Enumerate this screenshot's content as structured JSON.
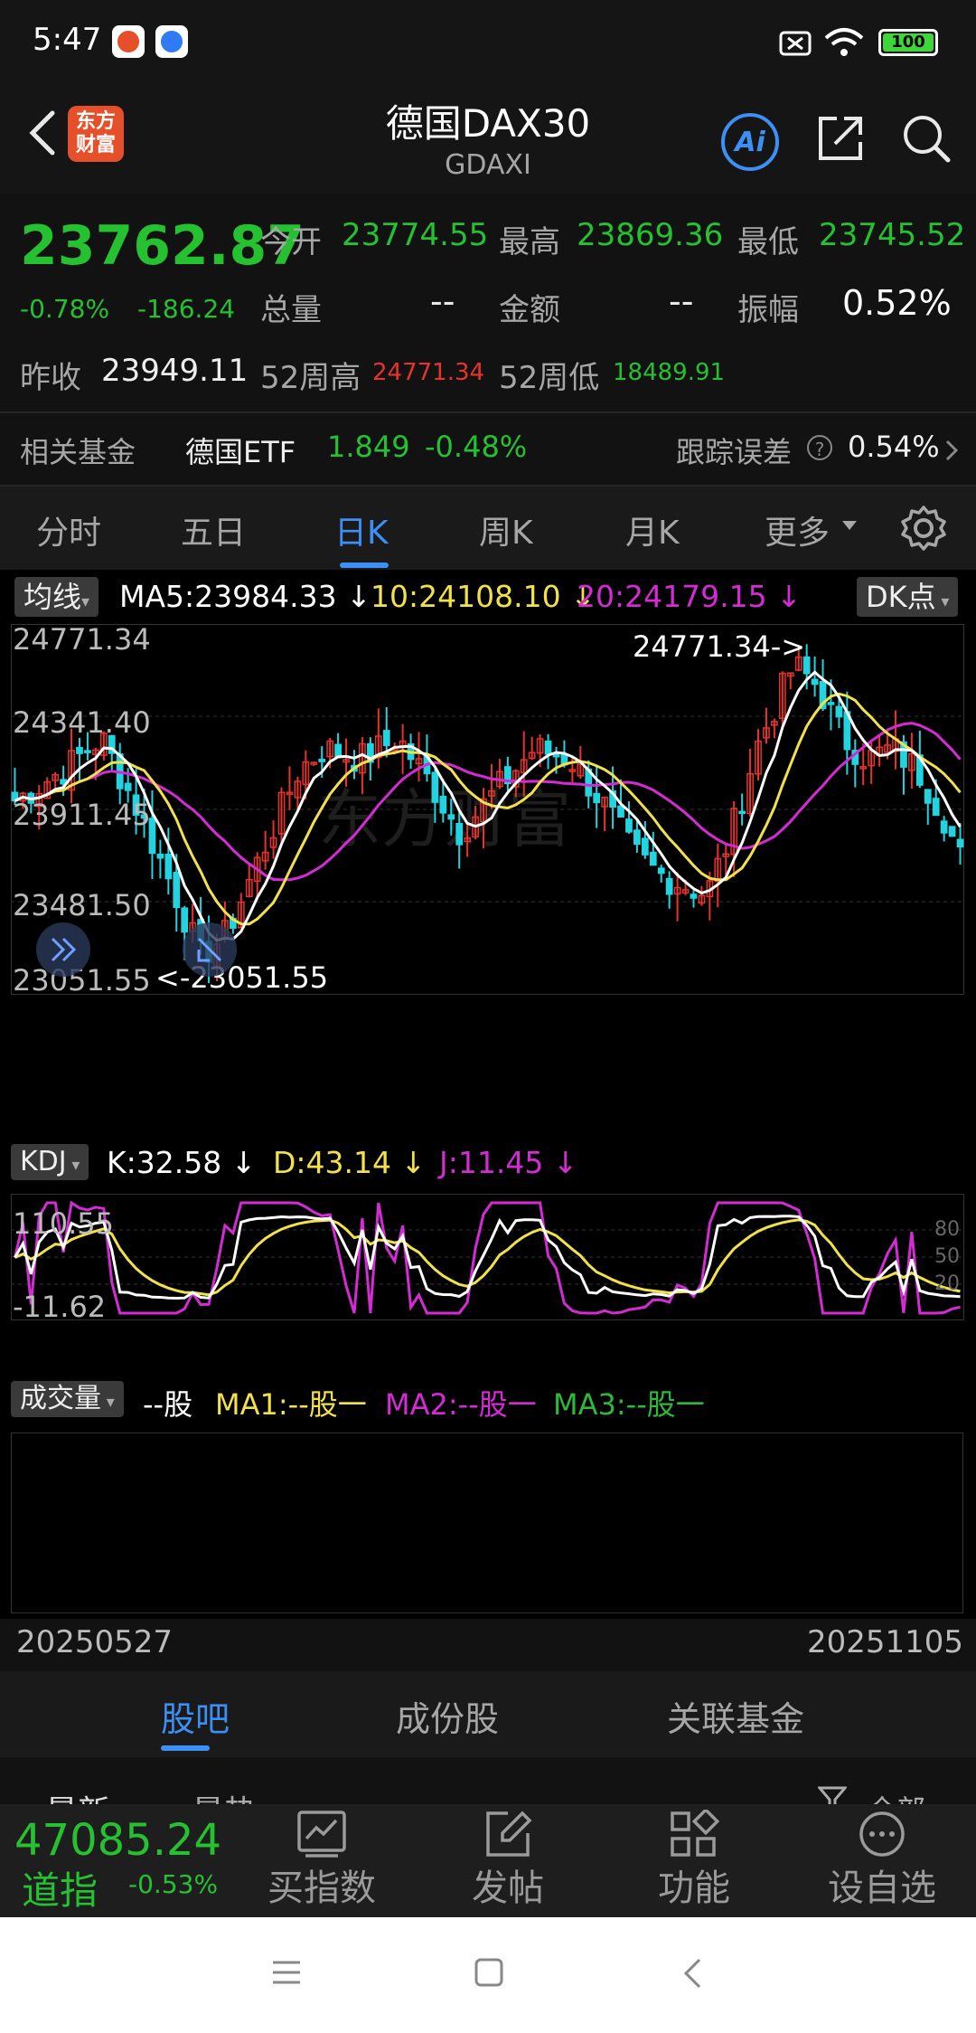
{
  "status": {
    "time": "5:47",
    "battery": "100"
  },
  "header": {
    "title": "德国DAX30",
    "subtitle": "GDAXI",
    "logo": "东方\n财富",
    "ai_label": "Ai"
  },
  "quote": {
    "price": "23762.87",
    "pct": "-0.78%",
    "change": "-186.24",
    "open_label": "今开",
    "open": "23774.55",
    "high_label": "最高",
    "high": "23869.36",
    "low_label": "最低",
    "low": "23745.52",
    "volume_label": "总量",
    "volume": "--",
    "amount_label": "金额",
    "amount": "--",
    "amplitude_label": "振幅",
    "amplitude": "0.52%",
    "prev_label": "昨收",
    "prev": "23949.11",
    "w52_high_label": "52周高",
    "w52_high": "24771.34",
    "w52_low_label": "52周低",
    "w52_low": "18489.91"
  },
  "fund": {
    "label": "相关基金",
    "name": "德国ETF",
    "price": "1.849",
    "pct": "-0.48%",
    "error_label": "跟踪误差",
    "error": "0.54%"
  },
  "tabs": [
    "分时",
    "五日",
    "日K",
    "周K",
    "月K",
    "更多"
  ],
  "main_chart": {
    "indicator": "均线",
    "ma5": "MA5:23984.33",
    "ma10": "10:24108.10",
    "ma20": "20:24179.15",
    "dk": "DK点",
    "y_labels": [
      "24771.34",
      "24341.40",
      "23911.45",
      "23481.50",
      "23051.55"
    ],
    "max_marker": "24771.34->",
    "min_marker": "<-23051.55",
    "watermark": "东方财富"
  },
  "kdj": {
    "label": "KDJ",
    "k": "K:32.58",
    "d": "D:43.14",
    "j": "J:11.45",
    "top": "110.55",
    "bottom": "-11.62",
    "levels": [
      "80",
      "50",
      "20"
    ]
  },
  "volume": {
    "label": "成交量",
    "v": "--股",
    "ma1": "MA1:--股一",
    "ma2": "MA2:--股一",
    "ma3": "MA3:--股一"
  },
  "dates": {
    "start": "20250527",
    "end": "20251105"
  },
  "sub_tabs": [
    "股吧",
    "成份股",
    "关联基金"
  ],
  "posts": {
    "left1": "最新",
    "left2": "最热",
    "right": "全部"
  },
  "toolbar": {
    "index_value": "47085.24",
    "index_name": "道指",
    "index_pct": "-0.53%",
    "buy": "买指数",
    "post": "发帖",
    "func": "功能",
    "watch": "设自选"
  },
  "colors": {
    "up": "#e8332c",
    "down": "#26c131",
    "candle_down": "#22d3e0",
    "accent": "#3c8ff5",
    "ma5": "#ffffff",
    "ma10": "#f2e14a",
    "ma20": "#d42bd4"
  }
}
